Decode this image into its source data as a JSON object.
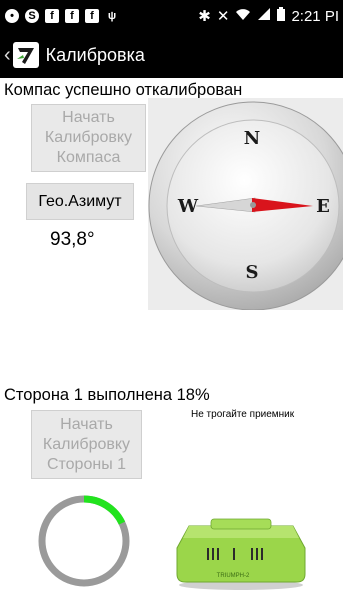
{
  "statusbar": {
    "time": "2:21 PI"
  },
  "actionbar": {
    "title": "Калибровка"
  },
  "status_text": "Компас успешно откалиброван",
  "buttons": {
    "start_compass": "Начать Калибровку Компаса",
    "geo_azimuth": "Гео.Азимут",
    "start_side": "Начать Калибровку Стороны 1"
  },
  "azimuth_value": "93,8°",
  "compass": {
    "north": "N",
    "south": "S",
    "west": "W",
    "east": "E",
    "needle_color": "#d9141c"
  },
  "side_status": "Сторона 1 выполнена 18%",
  "receiver_note": "Не трогайте приемник",
  "progress": {
    "percent": 18,
    "fill_color": "#22e31e",
    "track_color": "#9a9a9a"
  },
  "receiver": {
    "label": "TRIUMPH-2",
    "color": "#9bd64a"
  }
}
